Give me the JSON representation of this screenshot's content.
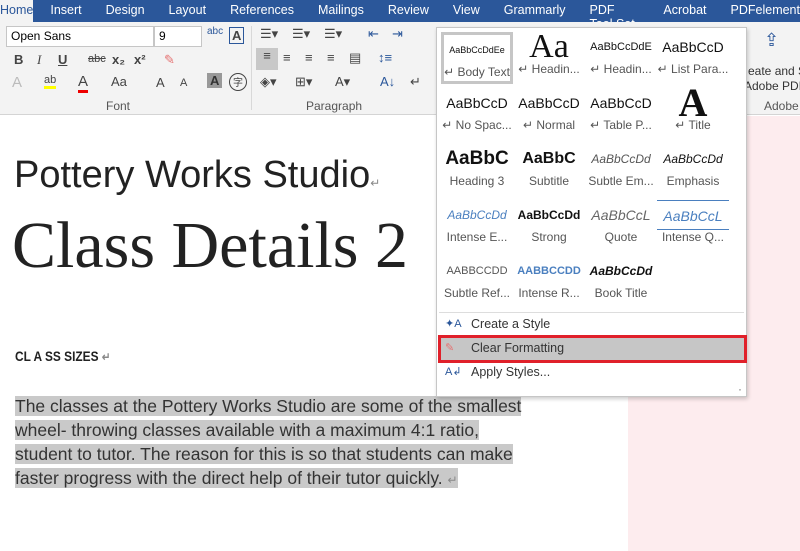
{
  "tabs": [
    "Home",
    "Insert",
    "Design",
    "Layout",
    "References",
    "Mailings",
    "Review",
    "View",
    "Grammarly",
    "PDF Tool Set",
    "Acrobat",
    "PDFelement"
  ],
  "ribbon": {
    "font_name": "Open Sans",
    "font_size": "9",
    "font_group": "Font",
    "paragraph_group": "Paragraph",
    "adobe_group": "Adobe",
    "adobe_btn_line1": "eate and Sh",
    "adobe_btn_line2": "Adobe PDF",
    "buttons": {
      "bold": "B",
      "italic": "I",
      "underline": "U",
      "strike": "abc",
      "sub": "x₂",
      "sup": "x²",
      "change_case": "Aa",
      "grow": "A",
      "shrink": "A"
    }
  },
  "document": {
    "title": "Pottery Works Studio",
    "heading": "Class Details 2",
    "subheading": "CL A SS SIZES",
    "paragraph_lines": [
      "The classes at the Pottery Works Studio are some of the smallest",
      "wheel- throwing classes available with a maximum 4:1 ratio,",
      "student to tutor. The reason for this is so that students can make",
      "faster progress with the direct help of their tutor quickly."
    ],
    "para_mark": "↵"
  },
  "styles": [
    {
      "preview": "AaBbCcDdEe",
      "label": "↵ Body Text"
    },
    {
      "preview": "Aa",
      "label": "↵ Headin..."
    },
    {
      "preview": "AaBbCcDdE",
      "label": "↵ Headin..."
    },
    {
      "preview": "AaBbCcD",
      "label": "↵ List Para..."
    },
    {
      "preview": "AaBbCcD",
      "label": "↵ No Spac..."
    },
    {
      "preview": "AaBbCcD",
      "label": "↵ Normal"
    },
    {
      "preview": "AaBbCcD",
      "label": "↵ Table P..."
    },
    {
      "preview": "A",
      "label": "↵ Title"
    },
    {
      "preview": "AaBbC",
      "label": "Heading 3"
    },
    {
      "preview": "AaBbC",
      "label": "Subtitle"
    },
    {
      "preview": "AaBbCcDd",
      "label": "Subtle Em..."
    },
    {
      "preview": "AaBbCcDd",
      "label": "Emphasis"
    },
    {
      "preview": "AaBbCcDd",
      "label": "Intense E..."
    },
    {
      "preview": "AaBbCcDd",
      "label": "Strong"
    },
    {
      "preview": "AaBbCcL",
      "label": "Quote"
    },
    {
      "preview": "AaBbCcL",
      "label": "Intense Q..."
    },
    {
      "preview": "AABBCCDD",
      "label": "Subtle Ref..."
    },
    {
      "preview": "AABBCCDD",
      "label": "Intense R..."
    },
    {
      "preview": "AaBbCcDd",
      "label": "Book Title"
    }
  ],
  "menu": {
    "create": "Create a Style",
    "clear": "Clear Formatting",
    "apply": "Apply Styles..."
  },
  "colors": {
    "tab_bar": "#2b579a",
    "highlight_box": "#e0202a",
    "selection": "#c9c9c9"
  }
}
